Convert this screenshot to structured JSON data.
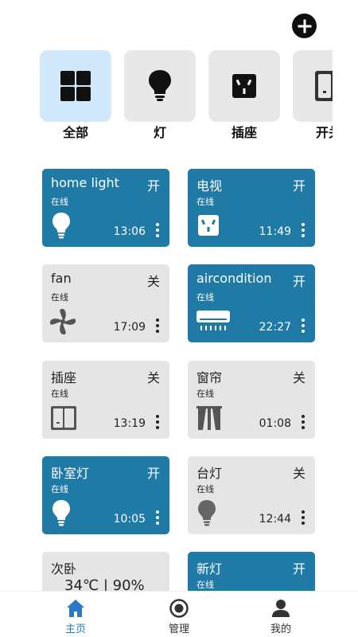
{
  "header": {
    "add_icon": "plus-circle-icon"
  },
  "categories": [
    {
      "label": "全部",
      "icon": "grid-icon",
      "active": true
    },
    {
      "label": "灯",
      "icon": "bulb-icon",
      "active": false
    },
    {
      "label": "插座",
      "icon": "socket-icon",
      "active": false
    },
    {
      "label": "开关",
      "icon": "switch-icon",
      "active": false
    }
  ],
  "devices": [
    {
      "name": "home light",
      "state": "开",
      "online": "在线",
      "time": "13:06",
      "icon": "bulb-icon",
      "on": true
    },
    {
      "name": "电视",
      "state": "开",
      "online": "在线",
      "time": "11:49",
      "icon": "socket-icon",
      "on": true
    },
    {
      "name": "fan",
      "state": "关",
      "online": "在线",
      "time": "17:09",
      "icon": "fan-icon",
      "on": false
    },
    {
      "name": "aircondition",
      "state": "开",
      "online": "在线",
      "time": "22:27",
      "icon": "air-conditioner-icon",
      "on": true
    },
    {
      "name": "插座",
      "state": "关",
      "online": "在线",
      "time": "13:19",
      "icon": "switch-icon",
      "on": false
    },
    {
      "name": "窗帘",
      "state": "关",
      "online": "在线",
      "time": "01:08",
      "icon": "curtain-icon",
      "on": false
    },
    {
      "name": "卧室灯",
      "state": "开",
      "online": "在线",
      "time": "10:05",
      "icon": "bulb-icon",
      "on": true
    },
    {
      "name": "台灯",
      "state": "关",
      "online": "在线",
      "time": "12:44",
      "icon": "bulb-icon",
      "on": false
    },
    {
      "name": "次卧",
      "temp": "34℃ | 90%",
      "on": false
    },
    {
      "name": "新灯",
      "state": "开",
      "online": "在线",
      "on": true
    }
  ],
  "nav": [
    {
      "label": "主页",
      "icon": "home-icon",
      "active": true
    },
    {
      "label": "管理",
      "icon": "radio-circle-icon",
      "active": false
    },
    {
      "label": "我的",
      "icon": "person-icon",
      "active": false
    }
  ],
  "colors": {
    "card_on": "#1f7aa6",
    "card_off": "#e5e5e5",
    "category_active": "#d2e8fb",
    "nav_active": "#2a78c6"
  }
}
